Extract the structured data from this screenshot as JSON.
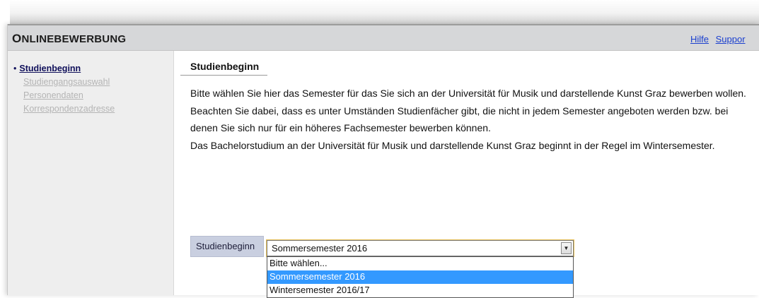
{
  "header": {
    "title_first_letter": "O",
    "title_rest": "NLINEBEWERBUNG",
    "links": [
      "Hilfe",
      "Suppor"
    ]
  },
  "sidebar": {
    "items": [
      {
        "label": "Studienbeginn",
        "state": "active"
      },
      {
        "label": "Studiengangsauswahl",
        "state": "disabled"
      },
      {
        "label": "Personendaten",
        "state": "disabled"
      },
      {
        "label": "Korrespondenzadresse",
        "state": "disabled"
      }
    ]
  },
  "main": {
    "section_title": "Studienbeginn",
    "paragraphs": [
      "Bitte wählen Sie hier das Semester für das Sie sich an der Universität für Musik und darstellende Kunst Graz bewerben wollen.",
      "Beachten Sie dabei, dass es unter Umständen Studienfächer gibt, die nicht in jedem Semester angeboten werden bzw. bei denen Sie sich nur für ein höheres Fachsemester bewerben können.",
      "Das Bachelorstudium an der Universität für Musik und darstellende Kunst Graz beginnt in der Regel im Wintersemester."
    ],
    "field": {
      "label": "Studienbeginn",
      "selected_value": "Sommersemester 2016",
      "options": [
        "Bitte wählen...",
        "Sommersemester 2016",
        "Wintersemester 2016/17"
      ],
      "highlighted_index": 1
    }
  },
  "colors": {
    "header_bg": "#d6d7d9",
    "sidebar_bg": "#eeeeee",
    "link": "#1a3fcf",
    "label_bg": "#c9cfe0",
    "highlight": "#3399ff"
  }
}
